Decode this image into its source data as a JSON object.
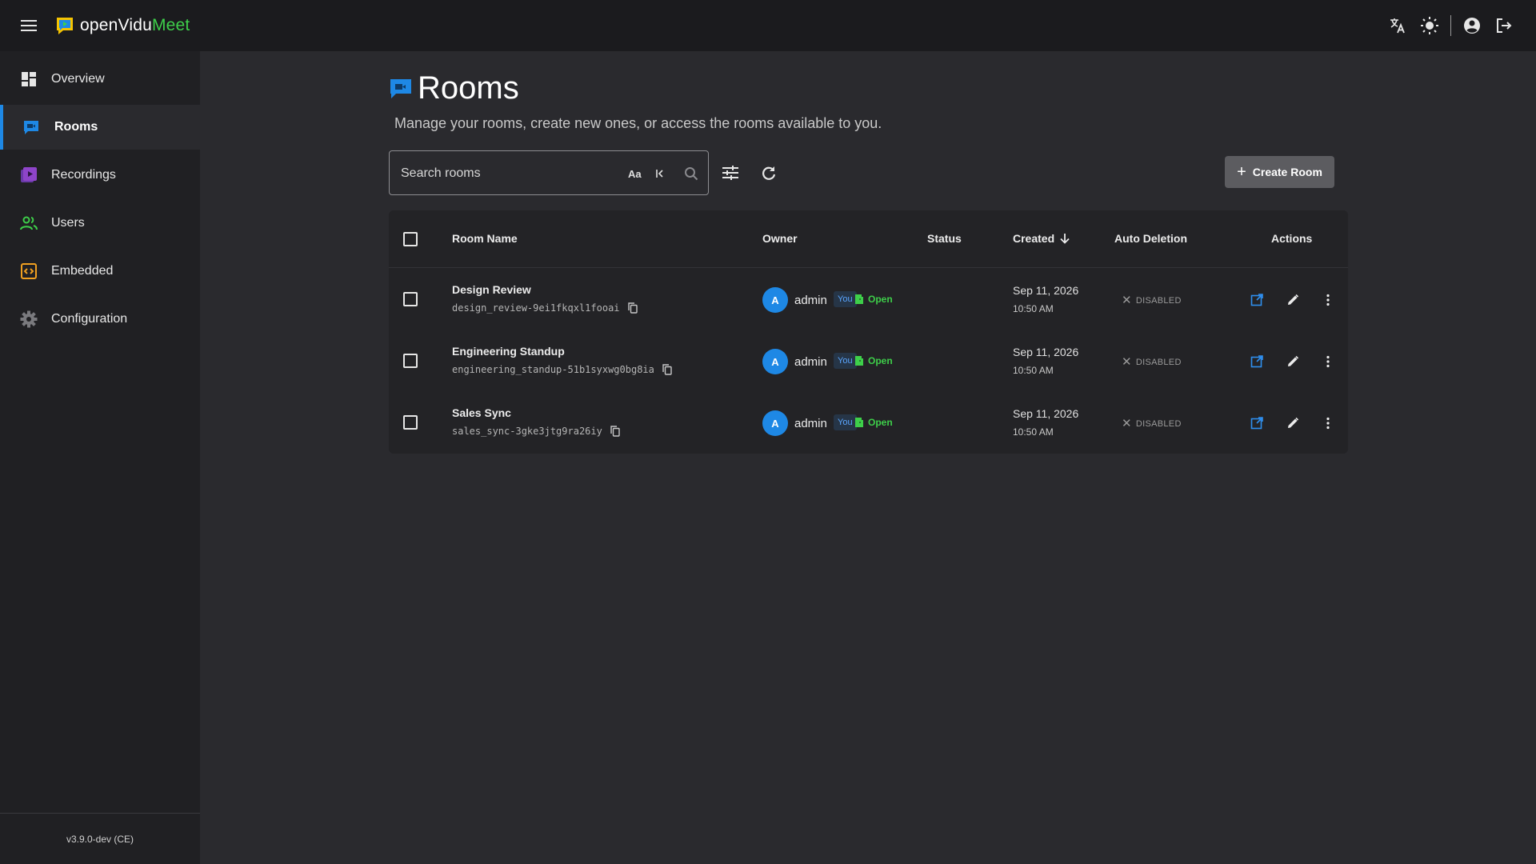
{
  "app": {
    "logo_prefix": "openVidu",
    "logo_suffix": "Meet",
    "accent_color": "#1e88e5",
    "brand_green": "#3ecf4a"
  },
  "topbar": {
    "icons": [
      "menu-icon",
      "translate-icon",
      "theme-toggle-icon",
      "account-icon",
      "logout-icon"
    ]
  },
  "sidebar": {
    "items": [
      {
        "label": "Overview",
        "icon": "dashboard-icon"
      },
      {
        "label": "Rooms",
        "icon": "rooms-icon",
        "active": true
      },
      {
        "label": "Recordings",
        "icon": "recordings-icon"
      },
      {
        "label": "Users",
        "icon": "users-icon"
      },
      {
        "label": "Embedded",
        "icon": "embedded-icon"
      },
      {
        "label": "Configuration",
        "icon": "gear-icon"
      }
    ],
    "version": "v3.9.0-dev (CE)"
  },
  "page": {
    "title": "Rooms",
    "subtitle": "Manage your rooms, create new ones, or access the rooms available to you."
  },
  "toolbar": {
    "search_placeholder": "Search rooms",
    "match_case_label": "Aa",
    "create_label": "Create Room"
  },
  "table": {
    "columns": {
      "name": "Room Name",
      "owner": "Owner",
      "status": "Status",
      "created": "Created",
      "auto_deletion": "Auto Deletion",
      "actions": "Actions"
    },
    "rows": [
      {
        "name": "Design Review",
        "id": "design_review-9ei1fkqxl1fooai",
        "owner_initial": "A",
        "owner": "admin",
        "badge": "You",
        "status": "Open",
        "created_date": "Sep 11, 2026",
        "created_time": "10:50 AM",
        "auto_deletion": "DISABLED"
      },
      {
        "name": "Engineering Standup",
        "id": "engineering_standup-51b1syxwg0bg8ia",
        "owner_initial": "A",
        "owner": "admin",
        "badge": "You",
        "status": "Open",
        "created_date": "Sep 11, 2026",
        "created_time": "10:50 AM",
        "auto_deletion": "DISABLED"
      },
      {
        "name": "Sales Sync",
        "id": "sales_sync-3gke3jtg9ra26iy",
        "owner_initial": "A",
        "owner": "admin",
        "badge": "You",
        "status": "Open",
        "created_date": "Sep 11, 2026",
        "created_time": "10:50 AM",
        "auto_deletion": "DISABLED"
      }
    ]
  }
}
